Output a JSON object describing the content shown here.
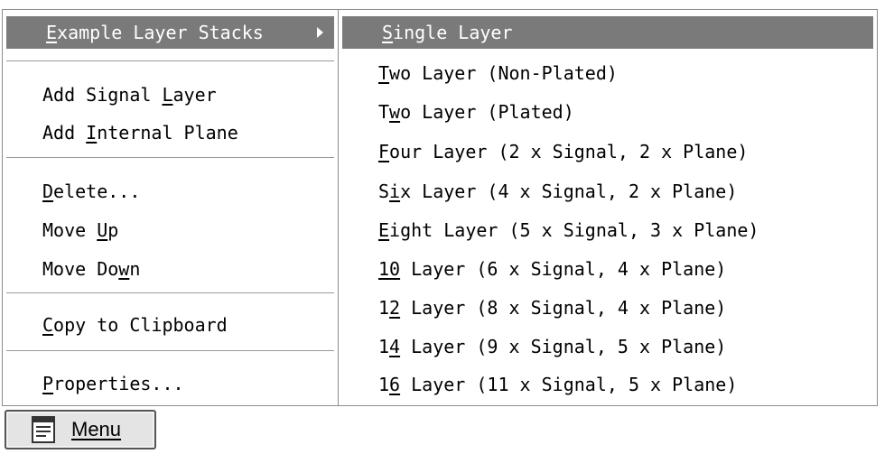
{
  "left_menu": {
    "items": [
      {
        "pre": "",
        "key": "E",
        "post": "xample Layer Stacks"
      },
      {
        "pre": "Add Signal ",
        "key": "L",
        "post": "ayer"
      },
      {
        "pre": "Add ",
        "key": "I",
        "post": "nternal Plane"
      },
      {
        "pre": "",
        "key": "D",
        "post": "elete..."
      },
      {
        "pre": "Move ",
        "key": "U",
        "post": "p"
      },
      {
        "pre": "Move Do",
        "key": "w",
        "post": "n"
      },
      {
        "pre": "",
        "key": "C",
        "post": "opy to Clipboard"
      },
      {
        "pre": "",
        "key": "P",
        "post": "roperties..."
      }
    ]
  },
  "submenu": {
    "items": [
      {
        "pre": "",
        "key": "S",
        "post": "ingle Layer"
      },
      {
        "pre": "",
        "key": "T",
        "post": "wo Layer (Non-Plated)"
      },
      {
        "pre": "T",
        "key": "w",
        "post": "o Layer (Plated)"
      },
      {
        "pre": "",
        "key": "F",
        "post": "our Layer (2 x Signal, 2 x Plane)"
      },
      {
        "pre": "S",
        "key": "i",
        "post": "x Layer (4 x Signal, 2 x Plane)"
      },
      {
        "pre": "",
        "key": "E",
        "post": "ight Layer (5 x Signal, 3 x Plane)"
      },
      {
        "pre": "",
        "key": "10",
        "post": " Layer (6 x Signal, 4 x Plane)"
      },
      {
        "pre": "1",
        "key": "2",
        "post": " Layer (8 x Signal, 4 x Plane)"
      },
      {
        "pre": "1",
        "key": "4",
        "post": " Layer (9 x Signal, 5 x Plane)"
      },
      {
        "pre": "1",
        "key": "6",
        "post": " Layer (11 x Signal, 5 x Plane)"
      }
    ]
  },
  "menu_button": {
    "label": "Menu",
    "icon": "menu-list-icon"
  },
  "colors": {
    "highlight": "#7a7a7a",
    "highlight_text": "#ffffff",
    "border": "#8c8c8c"
  }
}
